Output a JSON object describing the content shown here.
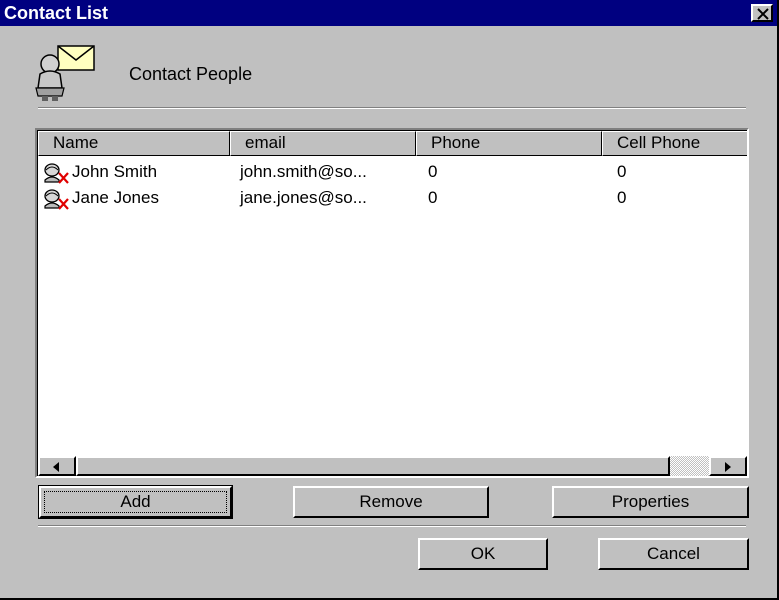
{
  "window": {
    "title": "Contact List"
  },
  "header": {
    "title": "Contact People",
    "icon": "contact-mail-icon"
  },
  "list": {
    "columns": [
      "Name",
      "email",
      "Phone",
      "Cell Phone"
    ],
    "rows": [
      {
        "name": "John Smith",
        "email": "john.smith@so...",
        "phone": "0",
        "cell": "0",
        "icon": "contact-person-icon"
      },
      {
        "name": "Jane Jones",
        "email": "jane.jones@so...",
        "phone": "0",
        "cell": "0",
        "icon": "contact-person-icon"
      }
    ]
  },
  "buttons": {
    "add": "Add",
    "remove": "Remove",
    "properties": "Properties",
    "ok": "OK",
    "cancel": "Cancel"
  },
  "colors": {
    "titlebar": "#000080",
    "face": "#c0c0c0",
    "delete_mark": "#e00000"
  }
}
